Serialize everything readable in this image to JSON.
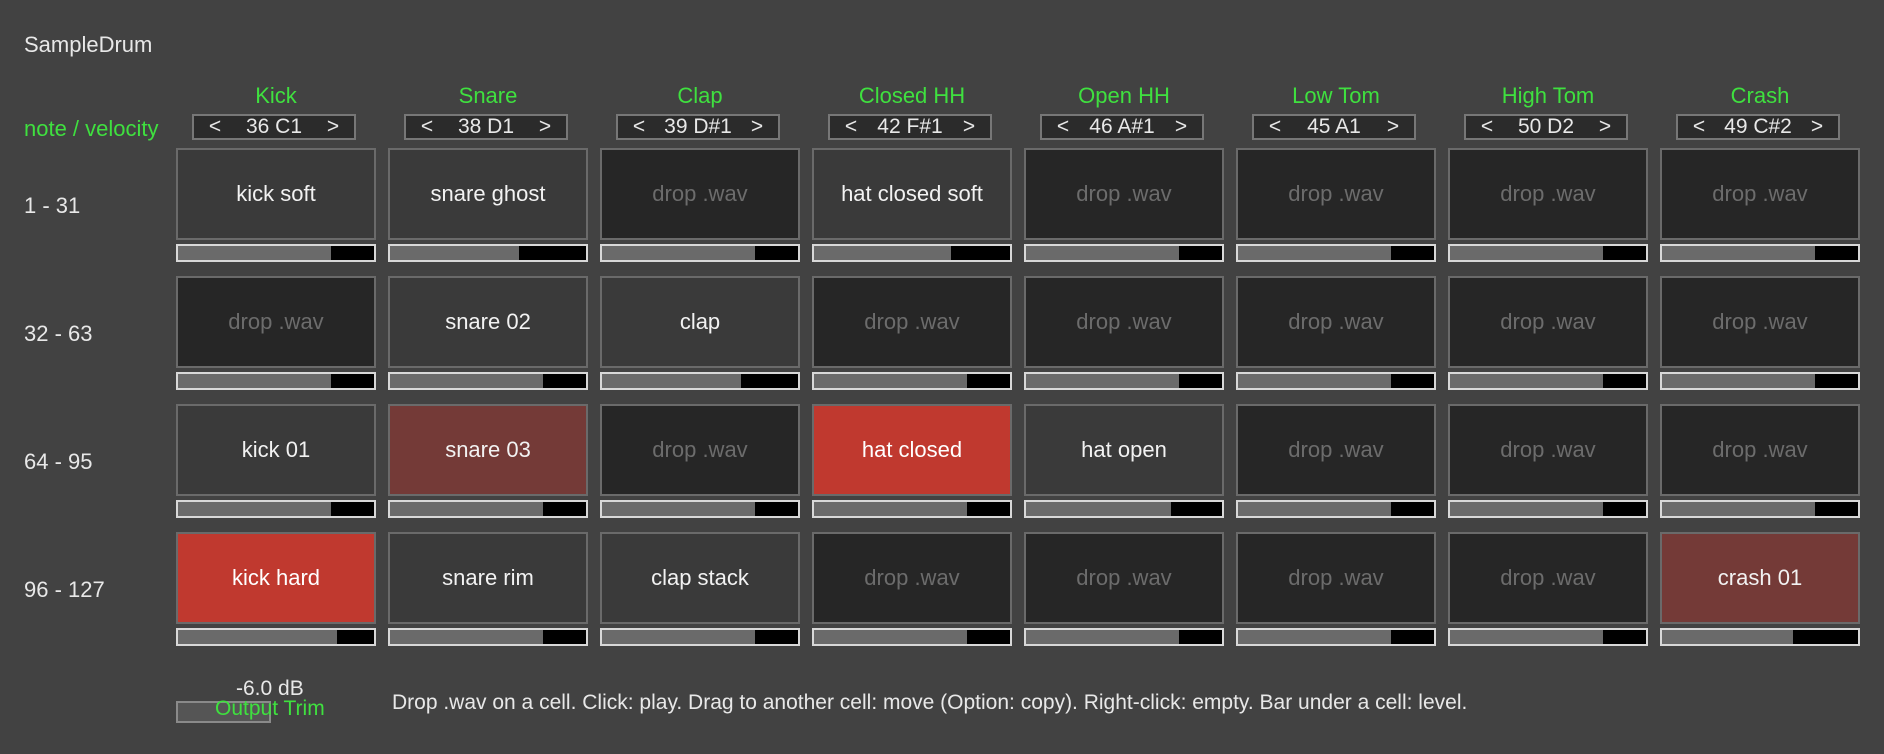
{
  "app": {
    "title": "SampleDrum"
  },
  "grid": {
    "note_velocity_label": "note / velocity",
    "columns": [
      {
        "name": "Kick",
        "note": "36 C1"
      },
      {
        "name": "Snare",
        "note": "38 D1"
      },
      {
        "name": "Clap",
        "note": "39 D#1"
      },
      {
        "name": "Closed HH",
        "note": "42 F#1"
      },
      {
        "name": "Open HH",
        "note": "46 A#1"
      },
      {
        "name": "Low Tom",
        "note": "45 A1"
      },
      {
        "name": "High Tom",
        "note": "50 D2"
      },
      {
        "name": "Crash",
        "note": "49 C#2"
      }
    ],
    "arrows": {
      "prev": "<",
      "next": ">"
    },
    "rows": [
      {
        "label": "1 - 31",
        "cells": [
          {
            "text": "kick soft",
            "state": "loaded",
            "level": 0.78
          },
          {
            "text": "snare ghost",
            "state": "loaded",
            "level": 0.66
          },
          {
            "text": "drop .wav",
            "state": "empty",
            "level": 0.78
          },
          {
            "text": "hat closed soft",
            "state": "loaded",
            "level": 0.7
          },
          {
            "text": "drop .wav",
            "state": "empty",
            "level": 0.78
          },
          {
            "text": "drop .wav",
            "state": "empty",
            "level": 0.78
          },
          {
            "text": "drop .wav",
            "state": "empty",
            "level": 0.78
          },
          {
            "text": "drop .wav",
            "state": "empty",
            "level": 0.78
          }
        ]
      },
      {
        "label": "32 - 63",
        "cells": [
          {
            "text": "drop .wav",
            "state": "empty",
            "level": 0.78
          },
          {
            "text": "snare 02",
            "state": "loaded",
            "level": 0.78
          },
          {
            "text": "clap",
            "state": "loaded",
            "level": 0.71
          },
          {
            "text": "drop .wav",
            "state": "empty",
            "level": 0.78
          },
          {
            "text": "drop .wav",
            "state": "empty",
            "level": 0.78
          },
          {
            "text": "drop .wav",
            "state": "empty",
            "level": 0.78
          },
          {
            "text": "drop .wav",
            "state": "empty",
            "level": 0.78
          },
          {
            "text": "drop .wav",
            "state": "empty",
            "level": 0.78
          }
        ]
      },
      {
        "label": "64 - 95",
        "cells": [
          {
            "text": "kick 01",
            "state": "loaded",
            "level": 0.78
          },
          {
            "text": "snare 03",
            "state": "mid",
            "level": 0.78
          },
          {
            "text": "drop .wav",
            "state": "empty",
            "level": 0.78
          },
          {
            "text": "hat closed",
            "state": "hot",
            "level": 0.78
          },
          {
            "text": "hat open",
            "state": "loaded",
            "level": 0.74
          },
          {
            "text": "drop .wav",
            "state": "empty",
            "level": 0.78
          },
          {
            "text": "drop .wav",
            "state": "empty",
            "level": 0.78
          },
          {
            "text": "drop .wav",
            "state": "empty",
            "level": 0.78
          }
        ]
      },
      {
        "label": "96 - 127",
        "cells": [
          {
            "text": "kick hard",
            "state": "hot",
            "level": 0.81
          },
          {
            "text": "snare rim",
            "state": "loaded",
            "level": 0.78
          },
          {
            "text": "clap stack",
            "state": "loaded",
            "level": 0.78
          },
          {
            "text": "drop .wav",
            "state": "empty",
            "level": 0.78
          },
          {
            "text": "drop .wav",
            "state": "empty",
            "level": 0.78
          },
          {
            "text": "drop .wav",
            "state": "empty",
            "level": 0.78
          },
          {
            "text": "drop .wav",
            "state": "empty",
            "level": 0.78
          },
          {
            "text": "crash 01",
            "state": "mid",
            "level": 0.67
          }
        ]
      }
    ]
  },
  "output_trim": {
    "value": "-6.0 dB",
    "label": "Output Trim",
    "level": 0.0
  },
  "help": {
    "text": "Drop .wav on a cell.  Click: play.  Drag to another cell: move (Option: copy).  Right-click: empty.  Bar under a cell: level."
  },
  "colors": {
    "background": "#424242",
    "accent_green": "#3fe03f",
    "cell_loaded": "#3a3a3a",
    "cell_empty": "#262626",
    "cell_mid": "#743a37",
    "cell_hot": "#c0392f"
  }
}
